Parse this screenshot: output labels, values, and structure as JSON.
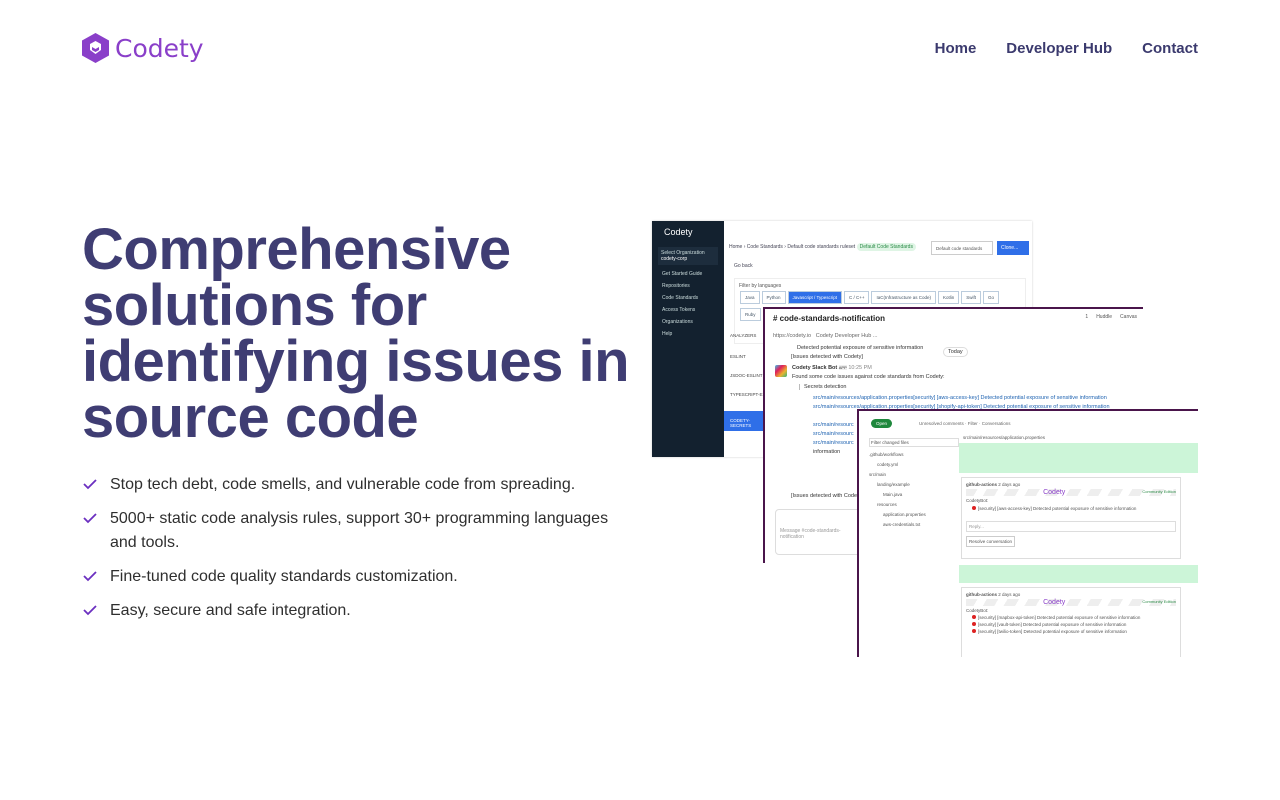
{
  "brand": {
    "name": "Codety",
    "color": "#8a3fc9"
  },
  "nav": [
    "Home",
    "Developer Hub",
    "Contact"
  ],
  "hero": {
    "title": "Comprehensive solutions for identifying issues in source code",
    "features": [
      "Stop tech debt, code smells, and vulnerable code from spreading.",
      "5000+ static code analysis rules, support 30+ programming languages and tools.",
      "Fine-tuned code quality standards customization.",
      "Easy, secure and safe integration."
    ]
  },
  "app": {
    "logo": "Codety",
    "org_label": "Select Organization",
    "org": "codety-corp",
    "menu": [
      "Get Started Guide",
      "Repositories",
      "Code Standards",
      "Access Tokens",
      "Organizations",
      "Help"
    ],
    "breadcrumb": "Home › Code Standards › Default code standards ruleset",
    "badge": "Default Code Standards",
    "select": "Default code standards",
    "clone": "Clone...",
    "back": "Go back",
    "filter": "Filter by languages",
    "langs": [
      "Java",
      "Python",
      "Javascript / Typescript",
      "C / C++",
      "IaC(Infrastructure as Code)",
      "Kotlin",
      "Swift",
      "Go",
      "Ruby"
    ],
    "analyzers_label": "ANALYZERS",
    "analyzers": [
      "ESLINT",
      "JSDOC-ESLINT",
      "TYPESCRIPT-ESLINT",
      "CODETY-SECRETS"
    ]
  },
  "slack": {
    "channel": "# code-standards-notification",
    "huddle": "Huddle",
    "canvas": "Canvas",
    "members": "1",
    "bookmarks": [
      "https://codety.io",
      "Codety Developer Hub ..."
    ],
    "today": "Today",
    "prev": "Detected potential exposure of sensitive information",
    "prev2": "[Issues detected with Codety]",
    "bot": "Codety Slack Bot",
    "app_tag": "APP",
    "time": "10:25 PM",
    "intro": "Found some code issues against code standards from Codety:",
    "section": "Secrets detection",
    "lines": [
      "src/main/resources/application.properties[security] [aws-access-key]  Detected potential exposure of sensitive information",
      "src/main/resources/application.properties[security] [shopify-api-token]  Detected potential exposure of sensitive information"
    ],
    "more": "src/main/resourc",
    "info": "information",
    "footer": "[Issues detected with Codety]",
    "composer": "Message #code-standards-notification"
  },
  "github": {
    "state": "Open",
    "filter": "Filter changed files",
    "toolbar": "Unresolved comments · Filter · Conversations",
    "files": [
      ".github/workflows",
      "codety.yml",
      "src/main",
      "landing/example",
      "Main.java",
      "resources",
      "application.properties",
      "aws-credentials.txt"
    ],
    "path": "src/main/resources/application.properties",
    "user": "github-actions",
    "when": "2 days ago",
    "edition": "Community Edition",
    "botname": "CodetyBot:",
    "issue1": "[security] [aws-access-key] Detected potential exposure of sensitive information",
    "reply": "Reply...",
    "resolve": "Resolve conversation",
    "issues2": [
      "[security] [mapbox-api-token] Detected potential exposure of sensitive information",
      "[security] [vault-token] Detected potential exposure of sensitive information",
      "[security] [twilio-token] Detected potential exposure of sensitive information"
    ]
  }
}
